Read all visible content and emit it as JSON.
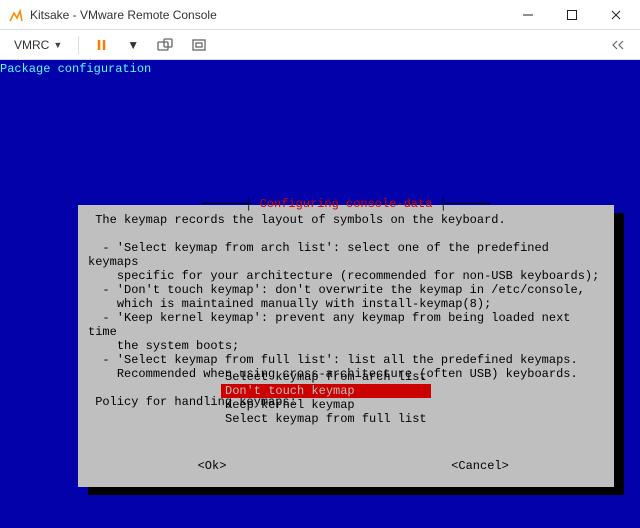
{
  "titlebar": {
    "title": "Kitsake - VMware Remote Console"
  },
  "toolbar": {
    "menu_label": "VMRC"
  },
  "console": {
    "header": "Package configuration",
    "dialog_title": "Configuring console-data",
    "body_intro": "The keymap records the layout of symbols on the keyboard.",
    "bullets": [
      "'Select keymap from arch list': select one of the predefined keymaps specific for your architecture (recommended for non-USB keyboards);",
      "'Don't touch keymap': don't overwrite the keymap in /etc/console, which is maintained manually with install-keymap(8);",
      "'Keep kernel keymap': prevent any keymap from being loaded next time the system boots;",
      "'Select keymap from full list': list all the predefined keymaps. Recommended when using cross-architecture (often USB) keyboards."
    ],
    "body_prompt": "Policy for handling keymaps:",
    "options": [
      {
        "label": "Select keymap from arch list",
        "selected": false
      },
      {
        "label": "Don't touch keymap",
        "selected": true
      },
      {
        "label": "Keep kernel keymap",
        "selected": false
      },
      {
        "label": "Select keymap from full list",
        "selected": false
      }
    ],
    "ok": "<Ok>",
    "cancel": "<Cancel>"
  }
}
